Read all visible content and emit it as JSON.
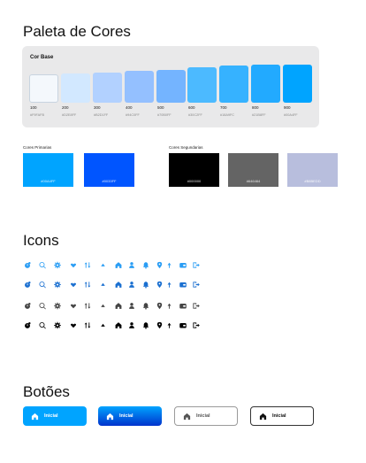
{
  "palette": {
    "title": "Paleta de Cores",
    "card_title": "Cor Base",
    "swatches": [
      {
        "step": "100",
        "hex": "#F9FAFB",
        "color": "#f4f8fc"
      },
      {
        "step": "200",
        "hex": "#D2E8FF",
        "color": "#d2e8ff"
      },
      {
        "step": "300",
        "hex": "#B2D1FF",
        "color": "#b2d1ff"
      },
      {
        "step": "400",
        "hex": "#94C0FF",
        "color": "#94c0ff"
      },
      {
        "step": "500",
        "hex": "#70B0FF",
        "color": "#74b4ff"
      },
      {
        "step": "600",
        "hex": "#30C2FF",
        "color": "#4cbaff"
      },
      {
        "step": "700",
        "hex": "#18A9FC",
        "color": "#36b2ff"
      },
      {
        "step": "800",
        "hex": "#21B8FF",
        "color": "#22aaff"
      },
      {
        "step": "900",
        "hex": "#00A4FF",
        "color": "#00a4ff"
      }
    ],
    "primary_label": "Cores Primarias",
    "primary": [
      {
        "hex": "#00A4FF",
        "color": "#00a4ff"
      },
      {
        "hex": "#0033FF",
        "color": "#0055ff"
      }
    ],
    "secondary_label": "Cores Segundarias",
    "secondary": [
      {
        "hex": "#000000",
        "color": "#000000"
      },
      {
        "hex": "#646464",
        "color": "#646464"
      },
      {
        "hex": "#B8BEDD",
        "color": "#b8bedd"
      }
    ]
  },
  "icons": {
    "title": "Icons",
    "row_colors": [
      "#2a9df4",
      "#1a6fd0",
      "#444444",
      "#000000"
    ],
    "names": [
      "alarm-icon",
      "search-icon",
      "settings-icon",
      "heart-icon",
      "sort-icon",
      "arrow-up-icon",
      "home-icon",
      "user-icon",
      "bell-icon",
      "location-icon",
      "plant-icon",
      "wallet-icon",
      "logout-icon"
    ]
  },
  "buttons": {
    "title": "Botões",
    "items": [
      {
        "label": "Inicial",
        "style": "solid"
      },
      {
        "label": "Inicial",
        "style": "gradient"
      },
      {
        "label": "Inicial",
        "style": "outline-gray"
      },
      {
        "label": "Inicial",
        "style": "outline-dark"
      }
    ]
  }
}
